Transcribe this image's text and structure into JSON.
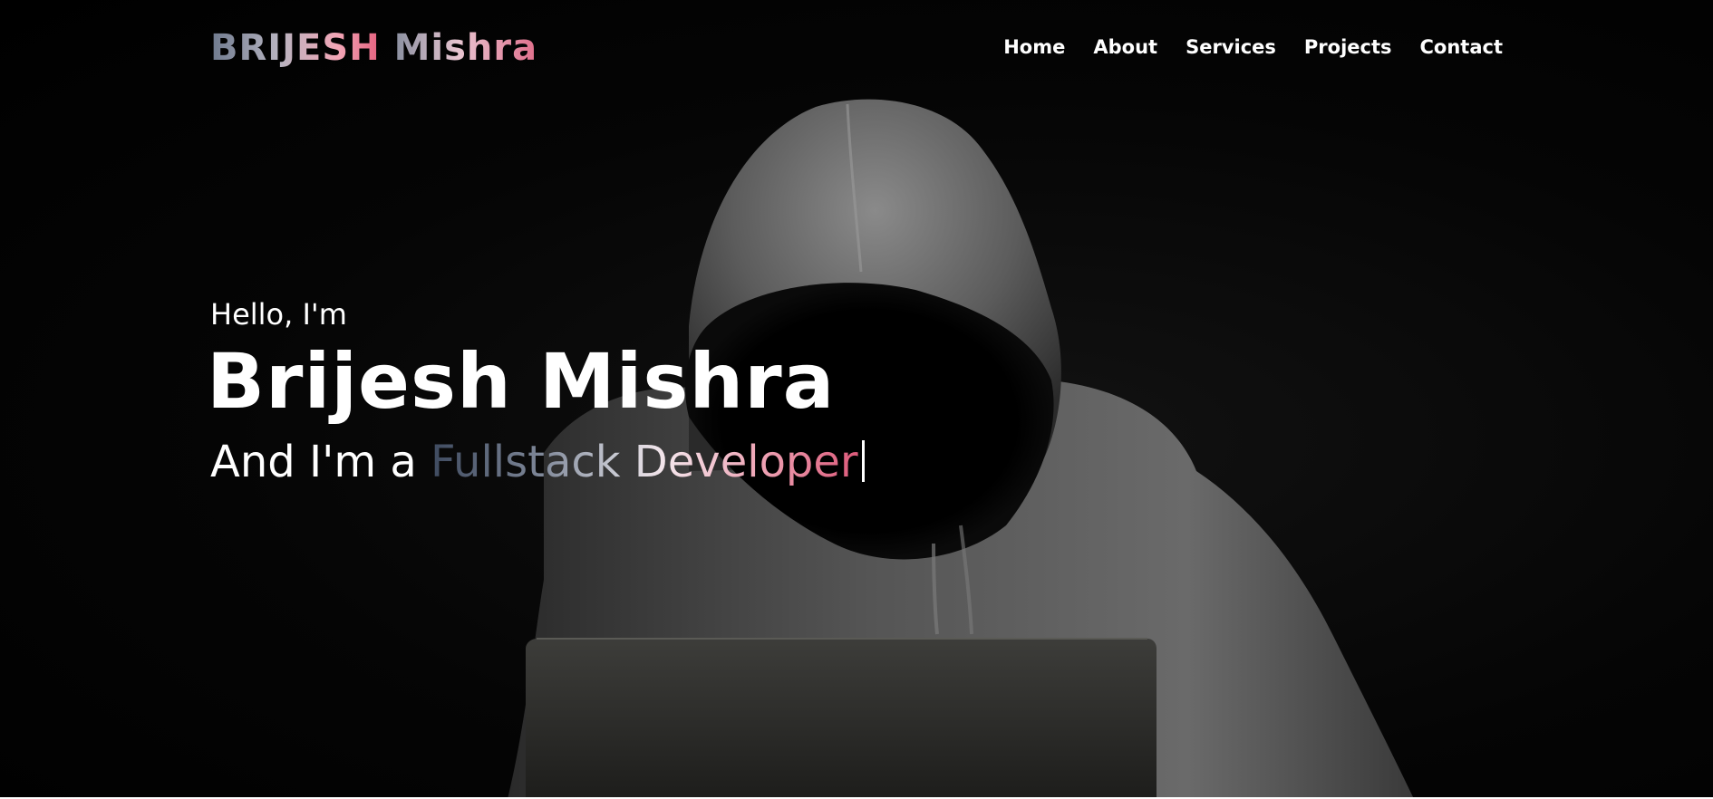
{
  "brand": {
    "first": "BRIJESH",
    "last": "Mishra"
  },
  "nav": {
    "items": [
      {
        "label": "Home"
      },
      {
        "label": "About"
      },
      {
        "label": "Services"
      },
      {
        "label": "Projects"
      },
      {
        "label": "Contact"
      }
    ]
  },
  "hero": {
    "greeting": "Hello, I'm",
    "name": "Brijesh Mishra",
    "role_prefix": "And I'm a ",
    "role": "Fullstack Developer"
  },
  "colors": {
    "background": "#000000",
    "text": "#ffffff",
    "accent_pink": "#e5607e",
    "accent_slate": "#6f7a8e"
  }
}
